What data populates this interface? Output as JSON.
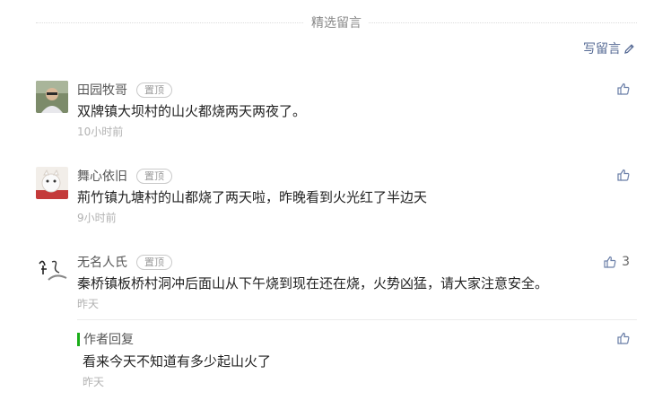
{
  "section_title": "精选留言",
  "write_label": "写留言",
  "pin_label": "置顶",
  "comments": [
    {
      "nickname": "田园牧哥",
      "content": "双牌镇大坝村的山火都烧两天两夜了。",
      "time": "10小时前",
      "likes": ""
    },
    {
      "nickname": "舞心依旧",
      "content": "荊竹镇九塘村的山都烧了两天啦，昨晚看到火光红了半边天",
      "time": "9小时前",
      "likes": ""
    },
    {
      "nickname": "无名人氏",
      "content": "秦桥镇板桥村洞冲后面山从下午烧到现在还在烧，火势凶猛，请大家注意安全。",
      "time": "昨天",
      "likes": "3"
    }
  ],
  "author_reply": {
    "label": "作者回复",
    "content": "看来今天不知道有多少起山火了",
    "time": "昨天"
  },
  "colors": {
    "link": "#576b95",
    "reply_bar": "#1aad19",
    "muted": "#b2b2b2"
  }
}
